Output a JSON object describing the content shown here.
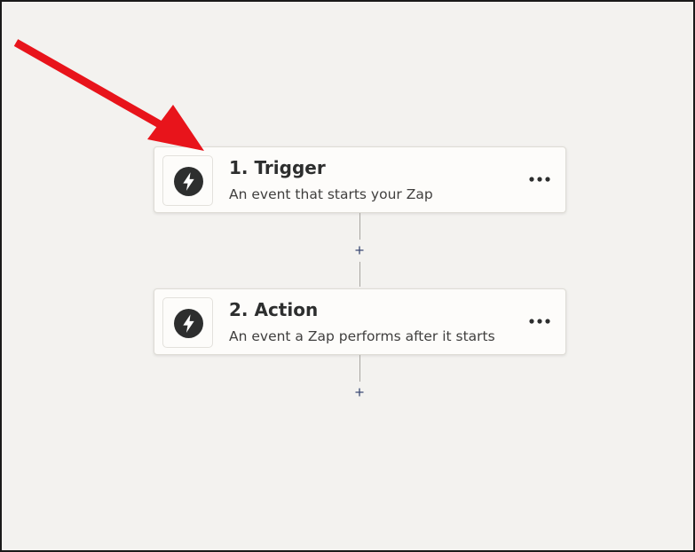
{
  "canvas": {
    "background_color": "#f3f2ef",
    "annotation_color": "#e8141b"
  },
  "steps": [
    {
      "title": "1. Trigger",
      "description": "An event that starts your Zap",
      "icon": "bolt-icon"
    },
    {
      "title": "2. Action",
      "description": "An event a Zap performs after it starts",
      "icon": "bolt-icon"
    }
  ],
  "controls": {
    "add_step_icon": "plus-icon",
    "step_menu_icon": "ellipsis-icon"
  },
  "annotation": {
    "icon": "red-arrow-icon"
  }
}
